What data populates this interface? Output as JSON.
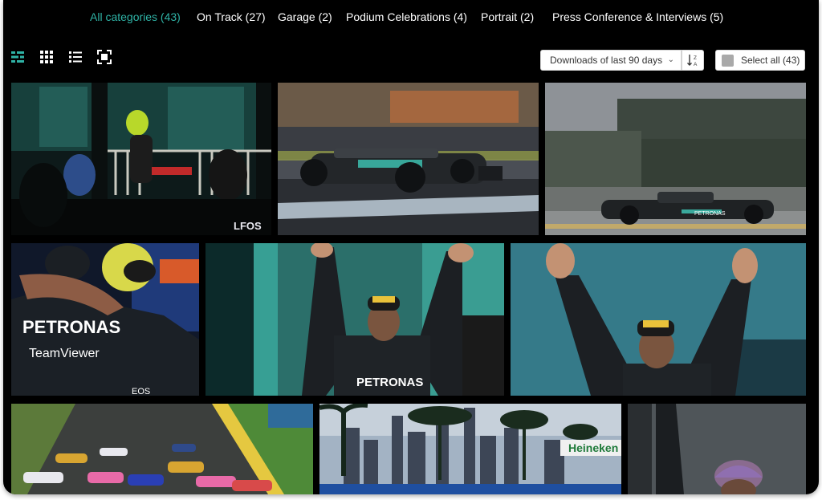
{
  "categories": [
    {
      "label": "All categories (43)",
      "active": true
    },
    {
      "label": "On Track (27)",
      "active": false
    },
    {
      "label": "Garage (2)",
      "active": false
    },
    {
      "label": "Podium Celebrations (4)",
      "active": false
    },
    {
      "label": "Portrait (2)",
      "active": false
    },
    {
      "label": "Press Conference & Interviews (5)",
      "active": false
    }
  ],
  "view_modes": [
    "masonry-view-icon",
    "grid-view-icon",
    "list-view-icon",
    "fullscreen-icon"
  ],
  "sort": {
    "selected": "Downloads of last 90 days",
    "direction_icon": "sort-z-a-icon"
  },
  "select_all_label": "Select all (43)",
  "photos": [
    {
      "name": "photo-fans-gate",
      "logo_text": "LFOS"
    },
    {
      "name": "photo-car-motion-blur",
      "sponsor_text": ""
    },
    {
      "name": "photo-car-panning",
      "sponsor_text": "PETRONAS"
    },
    {
      "name": "photo-team-hug",
      "sponsor_text": "PETRONAS",
      "sponsor_text_2": "TeamViewer",
      "sponsor_text_3": "EOS"
    },
    {
      "name": "photo-podium-arms-up",
      "sponsor_text": "PETRONAS"
    },
    {
      "name": "photo-podium-arms-up-close",
      "sponsor_text": ""
    },
    {
      "name": "photo-race-start",
      "sponsor_text": ""
    },
    {
      "name": "photo-city-skyline",
      "sponsor_text": "Heineken"
    },
    {
      "name": "photo-driver-purple-cap",
      "sponsor_text": ""
    }
  ],
  "colors": {
    "accent": "#2fb3a6",
    "background": "#000000",
    "text": "#ffffff"
  }
}
